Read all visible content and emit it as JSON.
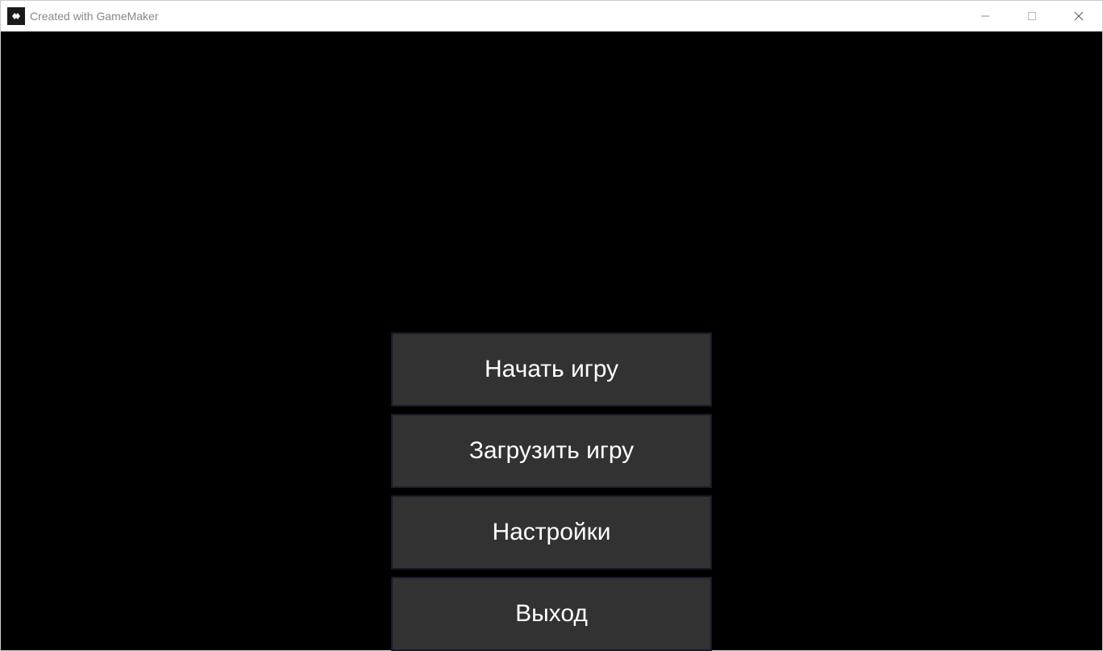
{
  "window": {
    "title": "Created with GameMaker"
  },
  "menu": {
    "items": [
      {
        "label": "Начать игру"
      },
      {
        "label": "Загрузить игру"
      },
      {
        "label": "Настройки"
      },
      {
        "label": "Выход"
      }
    ]
  }
}
